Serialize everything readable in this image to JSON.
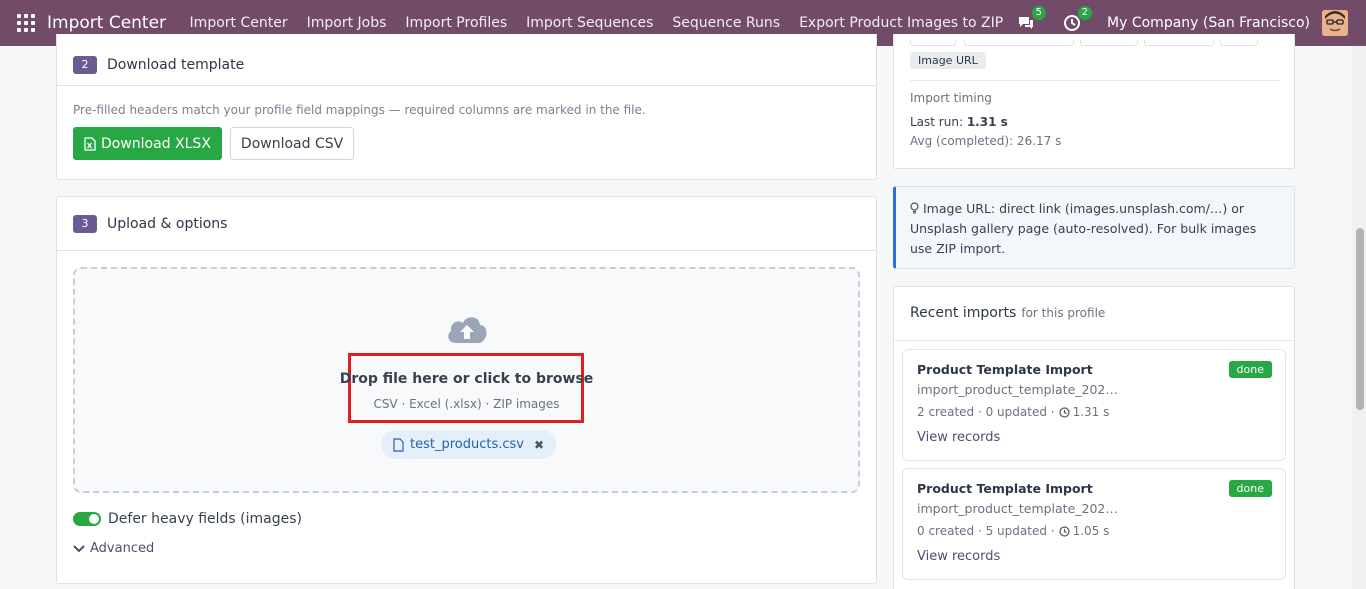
{
  "navbar": {
    "brand": "Import Center",
    "menu": [
      "Import Center",
      "Import Jobs",
      "Import Profiles",
      "Import Sequences",
      "Sequence Runs",
      "Export Product Images to ZIP"
    ],
    "messages_count": "5",
    "activities_count": "2",
    "company": "My Company (San Francisco)"
  },
  "download": {
    "step": "2",
    "title": "Download template",
    "hint": "Pre-filled headers match your profile field mappings — required columns are marked in the file.",
    "xlsx_label": "Download XLSX",
    "csv_label": "Download CSV"
  },
  "upload": {
    "step": "3",
    "title": "Upload & options",
    "drop_title": "Drop file here or click to browse",
    "drop_formats": "CSV · Excel (.xlsx) · ZIP images",
    "file_name": "test_products.csv",
    "defer_label": "Defer heavy fields (images)",
    "defer_enabled": true,
    "advanced_label": "Advanced"
  },
  "profile_info": {
    "tag": "Image URL",
    "timing_title": "Import timing",
    "last_run_label": "Last run:",
    "last_run_value": "1.31 s",
    "avg_text": "Avg (completed): 26.17 s"
  },
  "tip": {
    "text": "Image URL: direct link (images.unsplash.com/…) or Unsplash gallery page (auto-resolved). For bulk images use ZIP import."
  },
  "recent": {
    "title": "Recent imports",
    "subtitle": "for this profile",
    "items": [
      {
        "name": "Product Template Import",
        "status": "done",
        "file": "import_product_template_202…",
        "stats": "2 created · 0 updated ·",
        "duration": "1.31 s",
        "link": "View records"
      },
      {
        "name": "Product Template Import",
        "status": "done",
        "file": "import_product_template_202…",
        "stats": "0 created · 5 updated ·",
        "duration": "1.05 s",
        "link": "View records"
      }
    ]
  },
  "colors": {
    "navbar": "#714b67",
    "accent_green": "#28a745",
    "highlight_red": "#e11d1d",
    "tip_border": "#2f6fdc"
  }
}
